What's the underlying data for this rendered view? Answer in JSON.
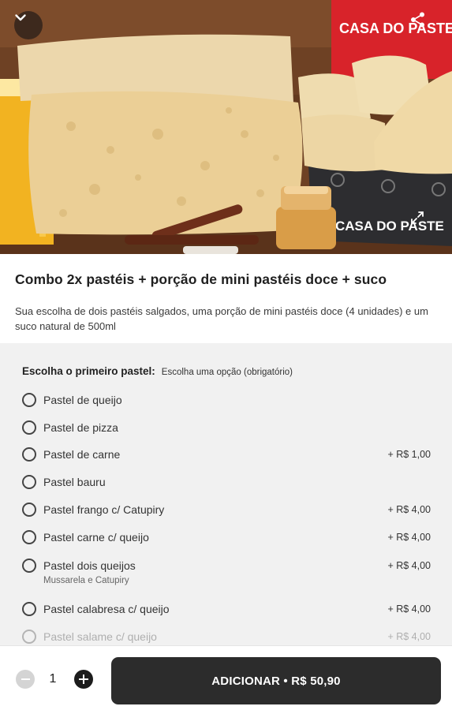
{
  "hero": {
    "brand_text_top": "CASA DO PASTE",
    "brand_text_box": "CASA DO PASTE",
    "icons": {
      "collapse": "chevron-down-icon",
      "share": "share-icon",
      "expand": "expand-icon"
    }
  },
  "product": {
    "title": "Combo 2x pastéis + porção de mini pastéis doce + suco",
    "description": "Sua escolha de dois pastéis salgados, uma porção de mini pastéis doce (4 unidades) e um suco natural de 500ml"
  },
  "options_group": {
    "title": "Escolha o primeiro pastel:",
    "subtitle": "Escolha uma opção (obrigatório)",
    "items": [
      {
        "label": "Pastel de queijo",
        "price": "",
        "sub": ""
      },
      {
        "label": "Pastel de pizza",
        "price": "",
        "sub": ""
      },
      {
        "label": "Pastel de carne",
        "price": "+ R$ 1,00",
        "sub": ""
      },
      {
        "label": "Pastel bauru",
        "price": "",
        "sub": ""
      },
      {
        "label": "Pastel frango c/ Catupiry",
        "price": "+ R$ 4,00",
        "sub": ""
      },
      {
        "label": "Pastel carne c/ queijo",
        "price": "+ R$ 4,00",
        "sub": ""
      },
      {
        "label": "Pastel dois queijos",
        "price": "+ R$ 4,00",
        "sub": "Mussarela e Catupiry"
      },
      {
        "label": "Pastel calabresa c/ queijo",
        "price": "+ R$ 4,00",
        "sub": ""
      },
      {
        "label": "Pastel salame c/ queijo",
        "price": "+ R$ 4,00",
        "sub": ""
      }
    ]
  },
  "footer": {
    "quantity": "1",
    "add_label": "ADICIONAR • R$ 50,90"
  },
  "colors": {
    "button_dark": "#2c2c2c",
    "options_bg": "#f1f1f1",
    "brand_red": "#d8232a"
  }
}
